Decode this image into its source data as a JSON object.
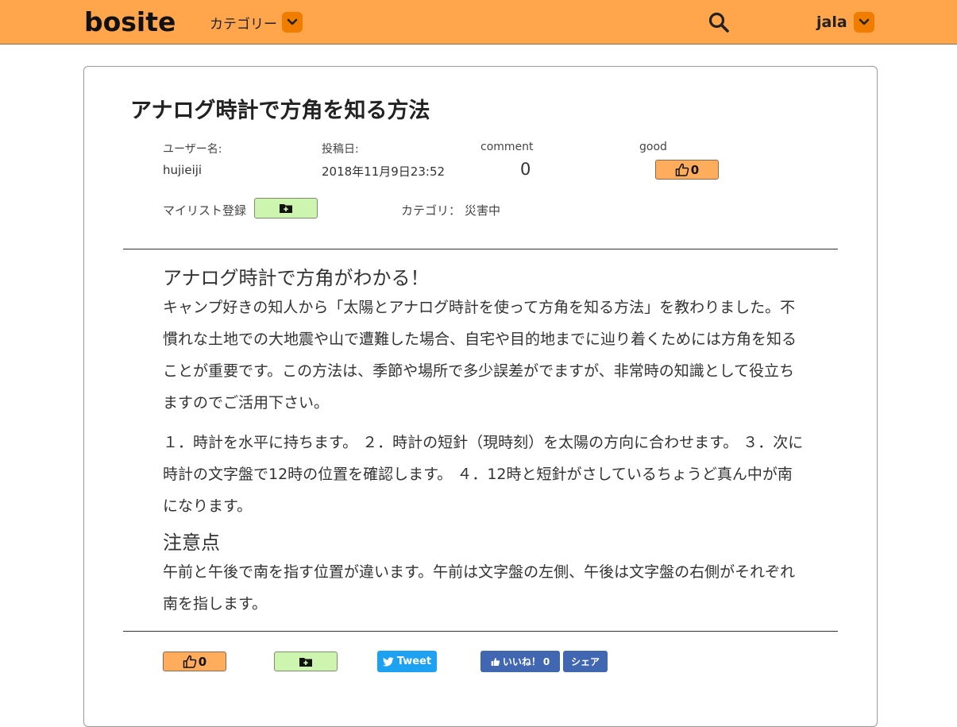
{
  "header": {
    "logo": "bosite",
    "category_menu_label": "カテゴリー",
    "username": "jala"
  },
  "article": {
    "title": "アナログ時計で方角を知る方法",
    "meta": {
      "user_label": "ユーザー名:",
      "user_value": "hujieiji",
      "date_label": "投稿日:",
      "date_value": "2018年11月9日23:52",
      "comment_label": "comment",
      "comment_value": "0",
      "good_label": "good",
      "good_count": "0"
    },
    "mylist_label": "マイリスト登録",
    "category_label": "カテゴリ：",
    "category_value": "災害中",
    "heading": "アナログ時計で方角がわかる！",
    "intro": "キャンプ好きの知人から「太陽とアナログ時計を使って方角を知る方法」を教わりました。不慣れな土地での大地震や山で遭難した場合、自宅や目的地までに辿り着くためには方角を知ることが重要です。この方法は、季節や場所で多少誤差がでますが、非常時の知識として役立ちますのでご活用下さい。",
    "steps": "１．時計を水平に持ちます。 ２．時計の短針（現時刻）を太陽の方向に合わせます。 ３．次に時計の文字盤で12時の位置を確認します。 ４．12時と短針がさしているちょうど真ん中が南になります。",
    "note_heading": "注意点",
    "note": "午前と午後で南を指す位置が違います。午前は文字盤の左側、午後は文字盤の右側がそれぞれ南を指します。"
  },
  "footer_actions": {
    "good_count": "0",
    "tweet_label": "Tweet",
    "fb_like_label": "いいね！",
    "fb_like_count": "0",
    "fb_share_label": "シェア"
  },
  "colors": {
    "header_bg": "#ffa64d",
    "chevron_bg": "#f07c00",
    "good_bg": "#ffad5c",
    "folder_bg": "#cdf5b0",
    "twitter": "#1da1f2",
    "facebook": "#4267b2"
  }
}
